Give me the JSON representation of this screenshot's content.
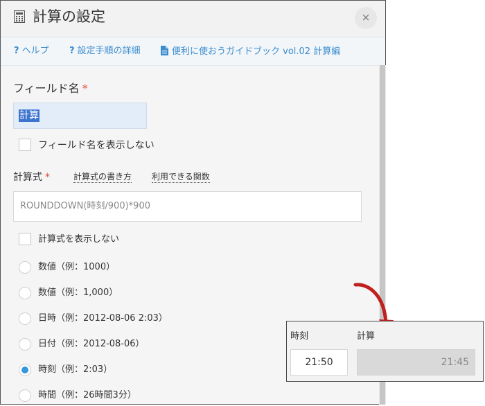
{
  "dialog": {
    "title": "計算の設定",
    "icon": "calculator-icon",
    "close_label": "×"
  },
  "help_bar": {
    "help_q": "?",
    "help": "ヘルプ",
    "steps_q": "?",
    "steps": "設定手順の詳細",
    "guide_icon": "document-icon",
    "guide": "便利に使おうガイドブック vol.02 計算編"
  },
  "field_name": {
    "label": "フィールド名",
    "required_mark": "*",
    "value": "計算",
    "hide_label": "フィールド名を表示しない"
  },
  "formula": {
    "label": "計算式",
    "required_mark": "*",
    "how_to_link": "計算式の書き方",
    "functions_link": "利用できる関数",
    "value": "ROUNDDOWN(時刻/900)*900",
    "hide_label": "計算式を表示しない"
  },
  "display_format": {
    "options": [
      {
        "label": "数値（例：1000）",
        "checked": false
      },
      {
        "label": "数値（例：1,000）",
        "checked": false
      },
      {
        "label": "日時（例：2012-08-06 2:03）",
        "checked": false
      },
      {
        "label": "日付（例：2012-08-06）",
        "checked": false
      },
      {
        "label": "時刻（例：2:03）",
        "checked": true
      },
      {
        "label": "時間（例：26時間3分）",
        "checked": false
      }
    ]
  },
  "example_panel": {
    "time_header": "時刻",
    "calc_header": "計算",
    "time_value": "21:50",
    "calc_value": "21:45"
  },
  "colors": {
    "accent": "#3b8ccf",
    "required": "#e74c3c",
    "selection": "#3d74cf",
    "arrow": "#c0201e",
    "radio_checked": "#3498db"
  }
}
